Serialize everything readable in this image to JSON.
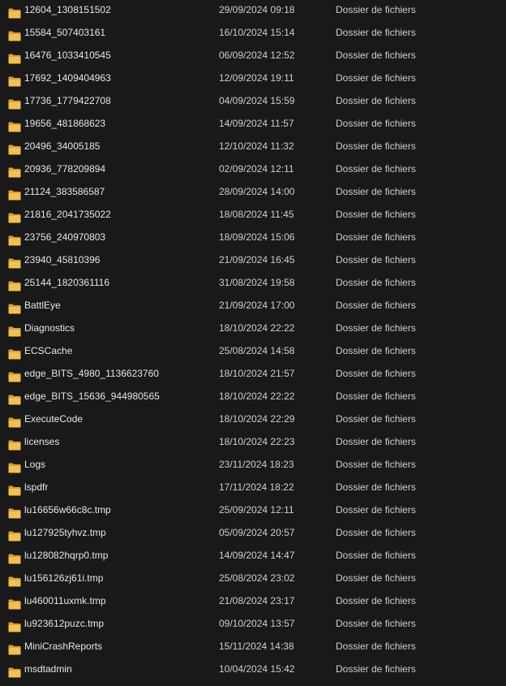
{
  "colors": {
    "background": "#191919",
    "text": "#e6e6e6",
    "secondary_text": "#cfcfcf",
    "folder_front": "#f2c14e",
    "folder_back": "#d9a12e"
  },
  "icons": {
    "row_icon": "folder-icon"
  },
  "files": [
    {
      "name": "12604_1308151502",
      "date": "29/09/2024 09:18",
      "type": "Dossier de fichiers"
    },
    {
      "name": "15584_507403161",
      "date": "16/10/2024 15:14",
      "type": "Dossier de fichiers"
    },
    {
      "name": "16476_1033410545",
      "date": "06/09/2024 12:52",
      "type": "Dossier de fichiers"
    },
    {
      "name": "17692_1409404963",
      "date": "12/09/2024 19:11",
      "type": "Dossier de fichiers"
    },
    {
      "name": "17736_1779422708",
      "date": "04/09/2024 15:59",
      "type": "Dossier de fichiers"
    },
    {
      "name": "19656_481868623",
      "date": "14/09/2024 11:57",
      "type": "Dossier de fichiers"
    },
    {
      "name": "20496_34005185",
      "date": "12/10/2024 11:32",
      "type": "Dossier de fichiers"
    },
    {
      "name": "20936_778209894",
      "date": "02/09/2024 12:11",
      "type": "Dossier de fichiers"
    },
    {
      "name": "21124_383586587",
      "date": "28/09/2024 14:00",
      "type": "Dossier de fichiers"
    },
    {
      "name": "21816_2041735022",
      "date": "18/08/2024 11:45",
      "type": "Dossier de fichiers"
    },
    {
      "name": "23756_240970803",
      "date": "18/09/2024 15:06",
      "type": "Dossier de fichiers"
    },
    {
      "name": "23940_45810396",
      "date": "21/09/2024 16:45",
      "type": "Dossier de fichiers"
    },
    {
      "name": "25144_1820361116",
      "date": "31/08/2024 19:58",
      "type": "Dossier de fichiers"
    },
    {
      "name": "BattlEye",
      "date": "21/09/2024 17:00",
      "type": "Dossier de fichiers"
    },
    {
      "name": "Diagnostics",
      "date": "18/10/2024 22:22",
      "type": "Dossier de fichiers"
    },
    {
      "name": "ECSCache",
      "date": "25/08/2024 14:58",
      "type": "Dossier de fichiers"
    },
    {
      "name": "edge_BITS_4980_1136623760",
      "date": "18/10/2024 21:57",
      "type": "Dossier de fichiers"
    },
    {
      "name": "edge_BITS_15636_944980565",
      "date": "18/10/2024 22:22",
      "type": "Dossier de fichiers"
    },
    {
      "name": "ExecuteCode",
      "date": "18/10/2024 22:29",
      "type": "Dossier de fichiers"
    },
    {
      "name": "licenses",
      "date": "18/10/2024 22:23",
      "type": "Dossier de fichiers"
    },
    {
      "name": "Logs",
      "date": "23/11/2024 18:23",
      "type": "Dossier de fichiers"
    },
    {
      "name": "lspdfr",
      "date": "17/11/2024 18:22",
      "type": "Dossier de fichiers"
    },
    {
      "name": "lu16656w66c8c.tmp",
      "date": "25/09/2024 12:11",
      "type": "Dossier de fichiers"
    },
    {
      "name": "lu127925tyhvz.tmp",
      "date": "05/09/2024 20:57",
      "type": "Dossier de fichiers"
    },
    {
      "name": "lu128082hqrp0.tmp",
      "date": "14/09/2024 14:47",
      "type": "Dossier de fichiers"
    },
    {
      "name": "lu156126zj61i.tmp",
      "date": "25/08/2024 23:02",
      "type": "Dossier de fichiers"
    },
    {
      "name": "lu460011uxmk.tmp",
      "date": "21/08/2024 23:17",
      "type": "Dossier de fichiers"
    },
    {
      "name": "lu923612puzc.tmp",
      "date": "09/10/2024 13:57",
      "type": "Dossier de fichiers"
    },
    {
      "name": "MiniCrashReports",
      "date": "15/11/2024 14:38",
      "type": "Dossier de fichiers"
    },
    {
      "name": "msdtadmin",
      "date": "10/04/2024 15:42",
      "type": "Dossier de fichiers"
    }
  ]
}
